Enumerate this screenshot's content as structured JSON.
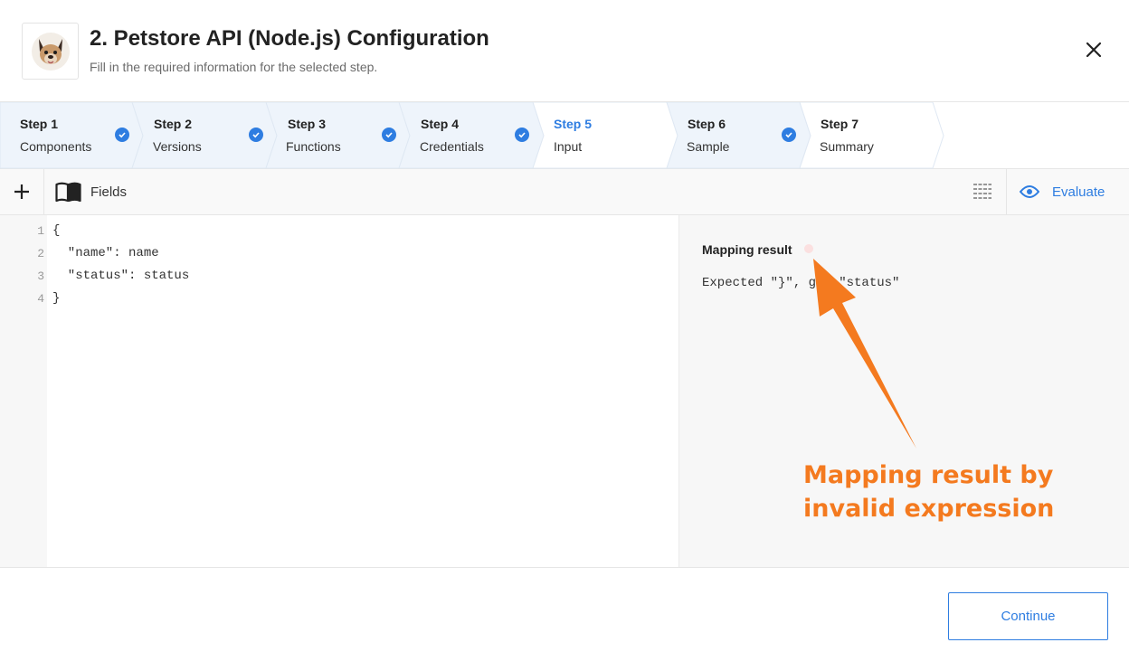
{
  "header": {
    "title": "2. Petstore API (Node.js) Configuration",
    "subtitle": "Fill in the required information for the selected step.",
    "logo_icon": "dog-avatar-icon",
    "close_icon": "close-icon"
  },
  "steps": [
    {
      "number": "Step 1",
      "name": "Components",
      "state": "completed"
    },
    {
      "number": "Step 2",
      "name": "Versions",
      "state": "completed"
    },
    {
      "number": "Step 3",
      "name": "Functions",
      "state": "completed"
    },
    {
      "number": "Step 4",
      "name": "Credentials",
      "state": "completed"
    },
    {
      "number": "Step 5",
      "name": "Input",
      "state": "active"
    },
    {
      "number": "Step 6",
      "name": "Sample",
      "state": "completed"
    },
    {
      "number": "Step 7",
      "name": "Summary",
      "state": "pending"
    }
  ],
  "toolbar": {
    "add_icon": "plus-icon",
    "fields_label": "Fields",
    "fields_icon": "book-icon",
    "format_icon": "align-justify-icon",
    "evaluate_label": "Evaluate",
    "evaluate_icon": "eye-icon"
  },
  "editor": {
    "lines": [
      {
        "num": "1",
        "text": "{"
      },
      {
        "num": "2",
        "text": "  \"name\": name"
      },
      {
        "num": "3",
        "text": "  \"status\": status"
      },
      {
        "num": "4",
        "text": "}"
      }
    ]
  },
  "result": {
    "title": "Mapping result",
    "status": "error",
    "message": "Expected \"}\", got \"status\""
  },
  "annotation": {
    "line1": "Mapping result by",
    "line2": "invalid expression"
  },
  "footer": {
    "continue_label": "Continue"
  },
  "colors": {
    "accent": "#2e7de1",
    "completed_step_bg": "#eef4fb",
    "annotation": "#f47a1f",
    "error_dot": "#fbe0e0"
  }
}
